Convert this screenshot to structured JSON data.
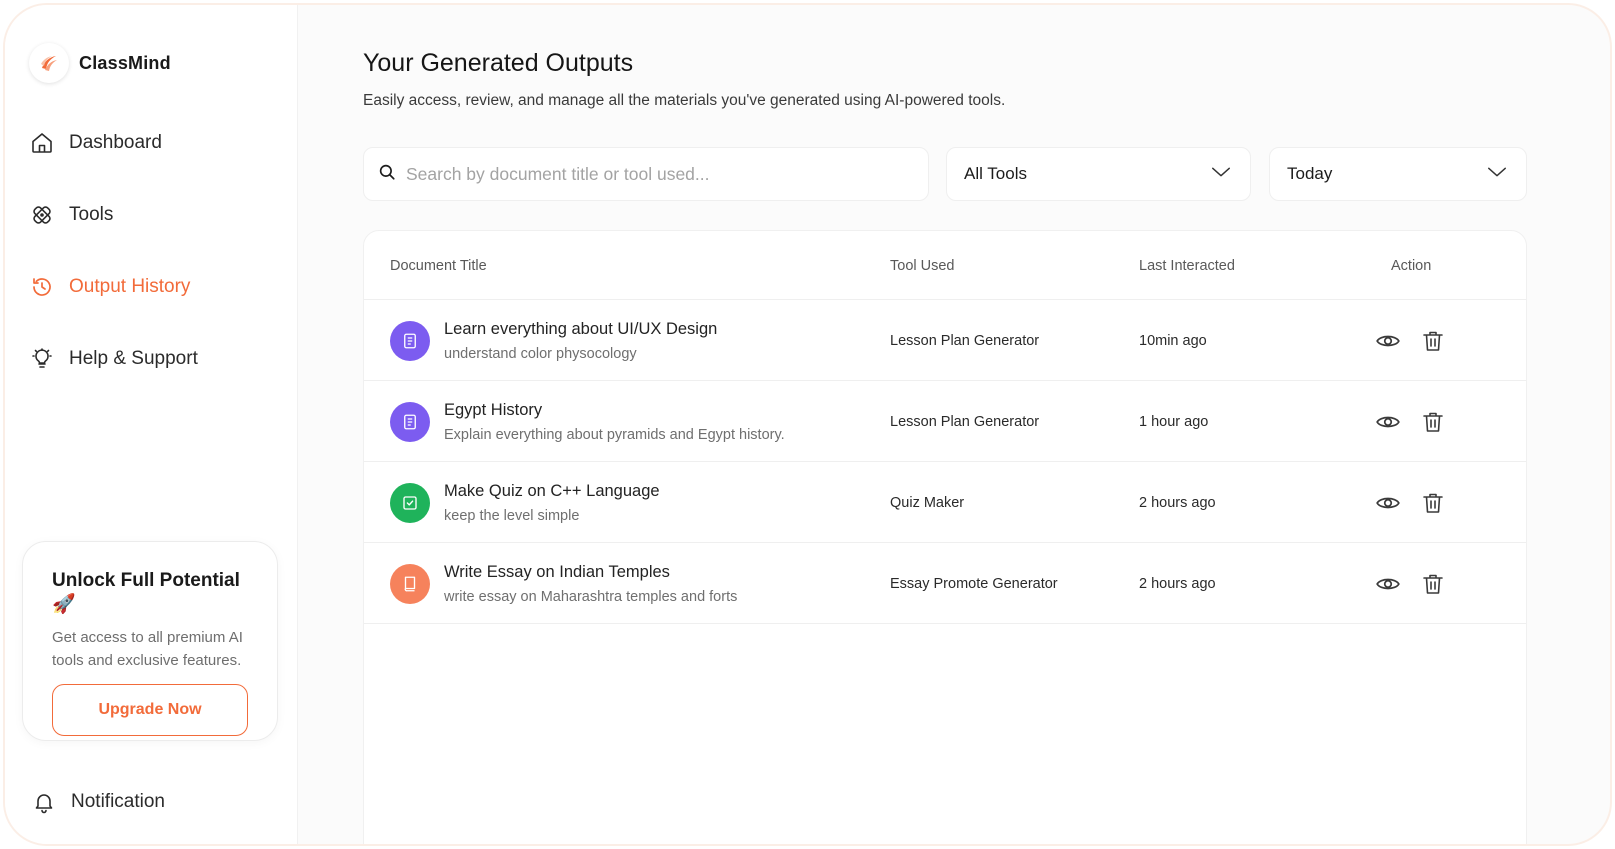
{
  "app": {
    "name": "ClassMind",
    "accent": "#f26b3a"
  },
  "sidebar": {
    "items": [
      {
        "label": "Dashboard",
        "icon": "home-icon",
        "active": false
      },
      {
        "label": "Tools",
        "icon": "tools-icon",
        "active": false
      },
      {
        "label": "Output History",
        "icon": "history-icon",
        "active": true
      },
      {
        "label": "Help & Support",
        "icon": "lightbulb-icon",
        "active": false
      }
    ],
    "promo": {
      "title": "Unlock Full Potential 🚀",
      "text": "Get access to all premium AI tools and exclusive features.",
      "button": "Upgrade Now"
    },
    "notification": "Notification"
  },
  "main": {
    "title": "Your Generated Outputs",
    "subtitle": "Easily access, review, and manage all the materials you've generated using AI-powered tools.",
    "search": {
      "placeholder": "Search by document title or tool used...",
      "value": ""
    },
    "filters": {
      "tool": "All Tools",
      "date": "Today"
    },
    "table": {
      "headers": [
        "Document Title",
        "Tool Used",
        "Last Interacted",
        "Action"
      ],
      "rows": [
        {
          "title": "Learn everything about UI/UX Design",
          "subtitle": "understand color physocology",
          "tool": "Lesson Plan Generator",
          "time": "10min ago",
          "icon": "book-icon",
          "color": "#7c5cf0"
        },
        {
          "title": "Egypt History",
          "subtitle": "Explain everything about pyramids and Egypt history.",
          "tool": "Lesson Plan Generator",
          "time": "1 hour ago",
          "icon": "book-icon",
          "color": "#7c5cf0"
        },
        {
          "title": "Make Quiz on C++ Language",
          "subtitle": "keep the level simple",
          "tool": "Quiz Maker",
          "time": "2 hours ago",
          "icon": "checkbox-icon",
          "color": "#1fb35b"
        },
        {
          "title": "Write Essay on Indian Temples",
          "subtitle": "write essay on Maharashtra temples and forts",
          "tool": "Essay Promote Generator",
          "time": "2 hours ago",
          "icon": "document-icon",
          "color": "#f6825c"
        }
      ]
    }
  }
}
